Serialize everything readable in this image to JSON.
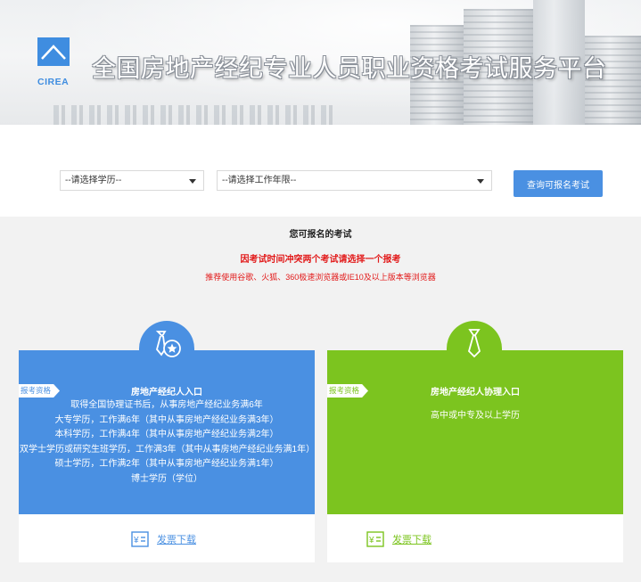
{
  "header": {
    "logo_text": "CIREA",
    "title": "全国房地产经纪专业人员职业资格考试服务平台"
  },
  "filters": {
    "education_select": {
      "selected": "--请选择学历--"
    },
    "years_select": {
      "selected": "--请选择工作年限--"
    },
    "query_button_label": "查询可报名考试"
  },
  "exam_section": {
    "title": "您可报名的考试",
    "warning": "因考试时间冲突两个考试请选择一个报考",
    "browser_tip": "推荐使用谷歌、火狐、360极速浏览器或IE10及以上版本等浏览器"
  },
  "cards": [
    {
      "tag": "报考资格",
      "name": "房地产经纪人入口",
      "requirements": [
        "取得全国协理证书后，从事房地产经纪业务满6年",
        "大专学历，工作满6年（其中从事房地产经纪业务满3年）",
        "本科学历，工作满4年（其中从事房地产经纪业务满2年）",
        "双学士学历或研究生班学历，工作满3年（其中从事房地产经纪业务满1年）",
        "硕士学历，工作满2年（其中从事房地产经纪业务满1年）",
        "博士学历（学位）"
      ],
      "download_label": "发票下载",
      "icon": "tie-star-icon",
      "color": "#4a90e2"
    },
    {
      "tag": "报考资格",
      "name": "房地产经纪人协理入口",
      "requirements": [
        "高中或中专及以上学历"
      ],
      "download_label": "发票下载",
      "icon": "tie-icon",
      "color": "#7cc41f"
    }
  ],
  "colors": {
    "primary_blue": "#4a90e2",
    "primary_green": "#7cc41f",
    "warning_red": "#e21a1a"
  }
}
